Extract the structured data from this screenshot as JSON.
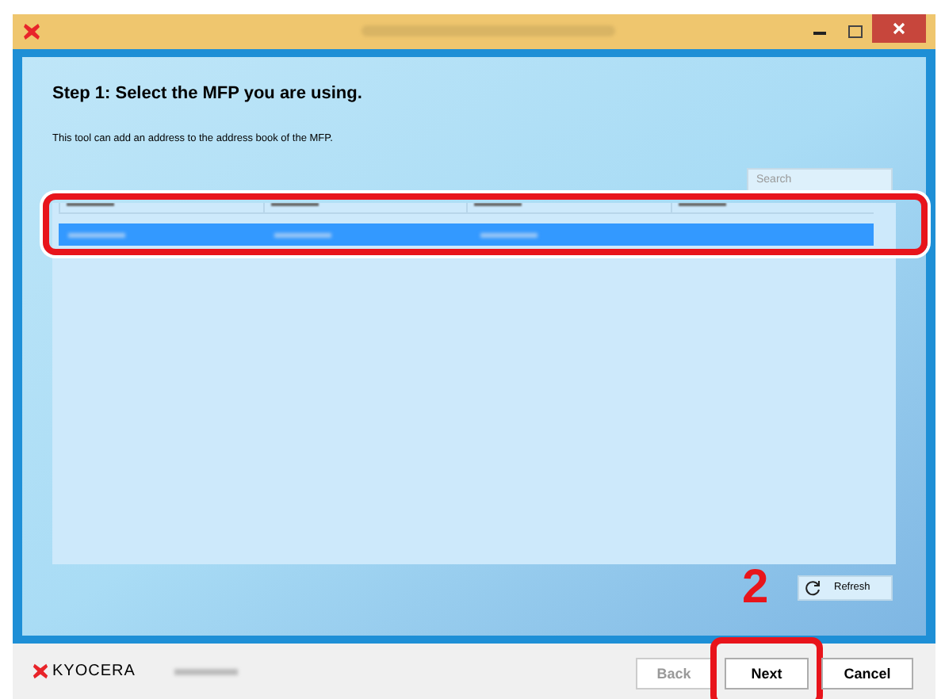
{
  "step": {
    "heading": "Step 1: Select the MFP you are using.",
    "description": "This tool can add an address to the address book of the MFP."
  },
  "search": {
    "placeholder": "Search"
  },
  "table": {
    "rows": [
      {
        "selected": true
      }
    ]
  },
  "refresh": {
    "label": "Refresh"
  },
  "annotation": {
    "label": "2"
  },
  "footer": {
    "logo": "KYOCERA"
  },
  "buttons": [
    {
      "label": "Back",
      "disabled": true,
      "highlighted": false
    },
    {
      "label": "Next",
      "disabled": false,
      "highlighted": true
    },
    {
      "label": "Cancel",
      "disabled": false,
      "highlighted": false
    }
  ]
}
